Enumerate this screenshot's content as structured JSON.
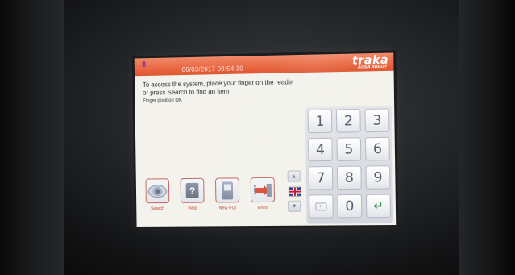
{
  "header": {
    "datetime": "06/03/2017 09:54:30",
    "brand": "traka",
    "brand_sub": "ASSA ABLOY"
  },
  "message": {
    "line1": "To access the system, place your finger on the reader",
    "line2": "or press Search to find an item",
    "status": "Finger position OK"
  },
  "function_buttons": [
    {
      "label": "Search",
      "icon": "eye-icon"
    },
    {
      "label": "Help",
      "icon": "help-icon"
    },
    {
      "label": "New PDI",
      "icon": "pda-icon"
    },
    {
      "label": "Enrol",
      "icon": "enrol-icon"
    }
  ],
  "scroll": {
    "up_icon": "arrow-up-icon",
    "down_icon": "arrow-down-icon",
    "language_icon": "uk-flag-icon"
  },
  "keypad": {
    "keys": [
      "1",
      "2",
      "3",
      "4",
      "5",
      "6",
      "7",
      "8",
      "9"
    ],
    "zero": "0",
    "backspace_icon": "backspace-icon",
    "enter_icon": "enter-icon"
  },
  "colors": {
    "header": "#ea6a45",
    "label_red": "#c2482e",
    "screen_bg": "#f3f2ec"
  }
}
